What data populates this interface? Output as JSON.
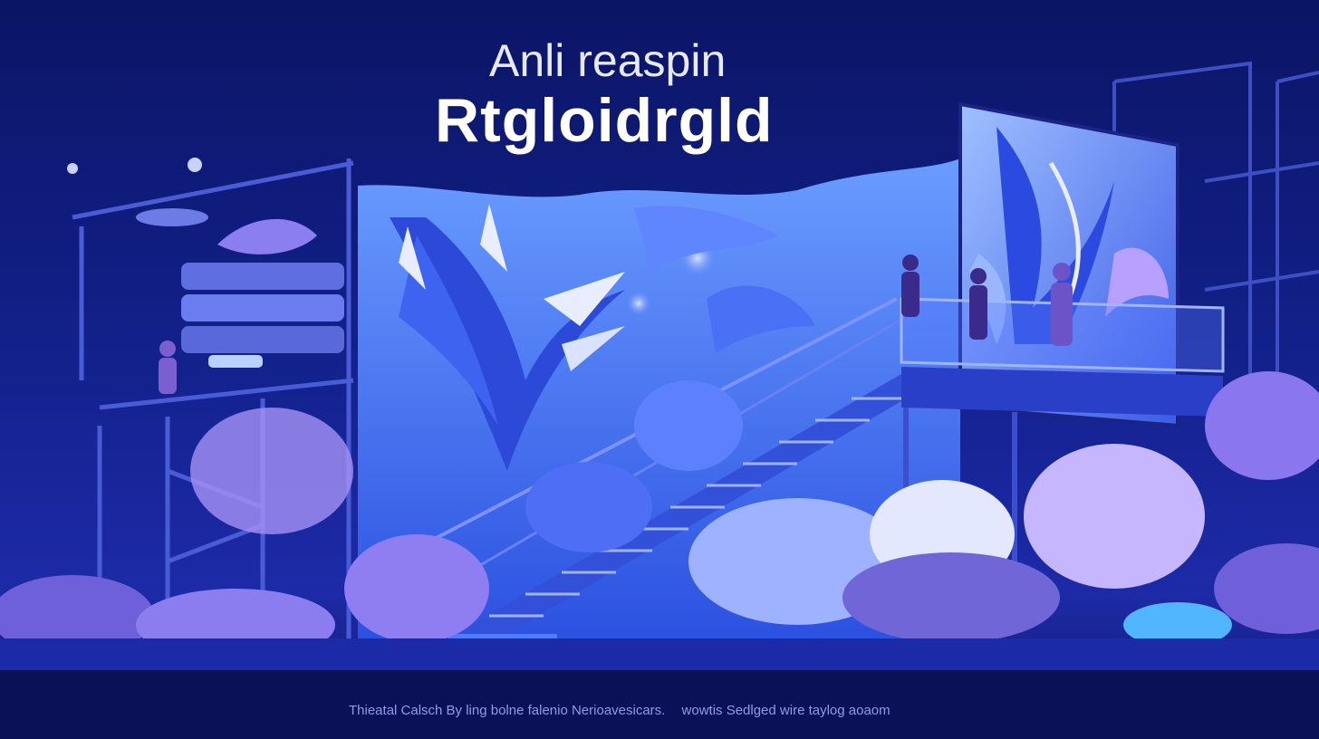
{
  "hero": {
    "subtitle": "Anli reaspin",
    "headline": "Rtgloidrgld"
  },
  "caption": {
    "part1": "Thieatal Calsch By ling bolne falenio  Nerioavesicars.",
    "part2": "wowtis  Sedlged wire taylog aoaom"
  },
  "colors": {
    "background": "#0c1660",
    "accent_blue": "#3b5bff",
    "accent_violet": "#8a6bf0",
    "cloud_light": "#c9b8ff"
  }
}
